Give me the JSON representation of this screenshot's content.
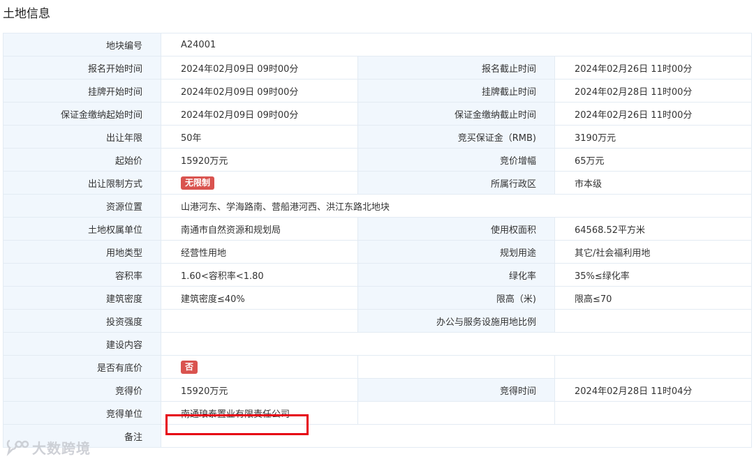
{
  "section_title": "土地信息",
  "fields": {
    "plot_no": {
      "label": "地块编号",
      "value": "A24001"
    },
    "reg_start": {
      "label": "报名开始时间",
      "value": "2024年02月09日 09时00分"
    },
    "reg_end": {
      "label": "报名截止时间",
      "value": "2024年02月26日 11时00分"
    },
    "listing_start": {
      "label": "挂牌开始时间",
      "value": "2024年02月09日 09时00分"
    },
    "listing_end": {
      "label": "挂牌截止时间",
      "value": "2024年02月28日 11时00分"
    },
    "deposit_start": {
      "label": "保证金缴纳起始时间",
      "value": "2024年02月09日 09时00分"
    },
    "deposit_end": {
      "label": "保证金缴纳截止时间",
      "value": "2024年02月26日 11时00分"
    },
    "term": {
      "label": "出让年限",
      "value": "50年"
    },
    "deposit": {
      "label": "竞买保证金（RMB)",
      "value": "3190万元"
    },
    "start_price": {
      "label": "起始价",
      "value": "15920万元"
    },
    "increment": {
      "label": "竞价增幅",
      "value": "65万元"
    },
    "restriction": {
      "label": "出让限制方式",
      "value": "无限制"
    },
    "district": {
      "label": "所属行政区",
      "value": "市本级"
    },
    "location": {
      "label": "资源位置",
      "value": "山港河东、学海路南、营船港河西、洪江东路北地块"
    },
    "owner_unit": {
      "label": "土地权属单位",
      "value": "南通市自然资源和规划局"
    },
    "use_area": {
      "label": "使用权面积",
      "value": "64568.52平方米"
    },
    "land_type": {
      "label": "用地类型",
      "value": "经营性用地"
    },
    "planned_use": {
      "label": "规划用途",
      "value": "其它/社会福利用地"
    },
    "far": {
      "label": "容积率",
      "value": "1.60<容积率<1.80"
    },
    "green": {
      "label": "绿化率",
      "value": "35%≤绿化率"
    },
    "density": {
      "label": "建筑密度",
      "value": "建筑密度≤40%"
    },
    "height": {
      "label": "限高（米)",
      "value": "限高≤70"
    },
    "investment": {
      "label": "投资强度",
      "value": ""
    },
    "office_ratio": {
      "label": "办公与服务设施用地比例",
      "value": ""
    },
    "content": {
      "label": "建设内容",
      "value": ""
    },
    "reserve": {
      "label": "是否有底价",
      "value": "否"
    },
    "win_price": {
      "label": "竞得价",
      "value": "15920万元"
    },
    "win_time": {
      "label": "竞得时间",
      "value": "2024年02月28日 11时04分"
    },
    "winner": {
      "label": "竞得单位",
      "value": "南通琅泰置业有限责任公司"
    },
    "remark": {
      "label": "备注",
      "value": ""
    }
  },
  "watermark": "大数跨境",
  "colors": {
    "label_bg": "#f1f7fd",
    "border": "#e3ebf3",
    "tag_red": "#d9534f",
    "highlight_box": "#e60012"
  }
}
